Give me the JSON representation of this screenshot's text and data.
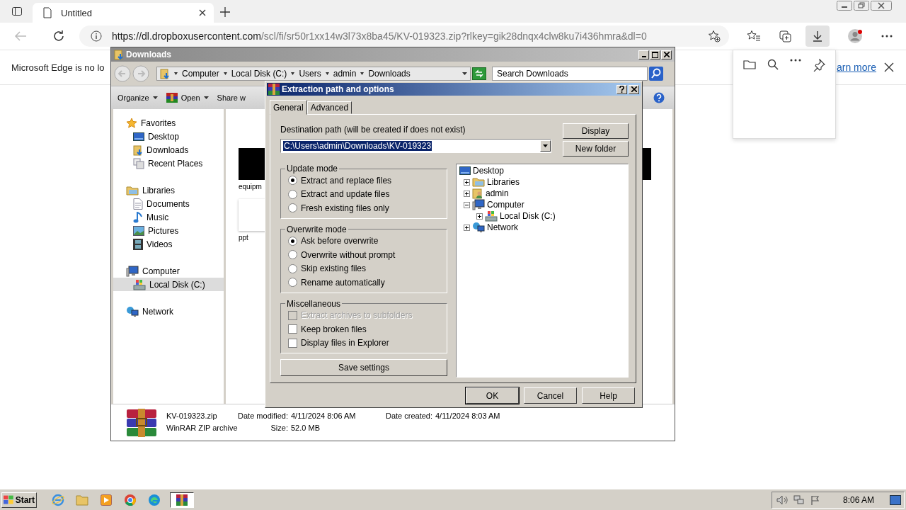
{
  "browser": {
    "tab": {
      "title": "Untitled"
    },
    "address": {
      "host": "https://dl.dropboxusercontent.com",
      "path": "/scl/fi/sr50r1xx14w3l73x8ba45/KV-019323.zip?rlkey=gik28dnqx4clw8ku7i436hmra&dl=0"
    },
    "infobar": {
      "message": "Microsoft Edge is no lo",
      "link": "arn more"
    }
  },
  "explorer": {
    "title": "Downloads",
    "breadcrumb": [
      "Computer",
      "Local Disk (C:)",
      "Users",
      "admin",
      "Downloads"
    ],
    "search": {
      "placeholder": "Search Downloads"
    },
    "toolbar": [
      {
        "label": "Organize",
        "kind": "menu"
      },
      {
        "label": "Open",
        "kind": "open"
      },
      {
        "label": "Share w",
        "kind": "plain"
      }
    ],
    "nav": [
      {
        "label": "Favorites",
        "kind": "star",
        "selected": false,
        "items": [
          {
            "label": "Desktop",
            "kind": "desktop",
            "selected": false
          },
          {
            "label": "Downloads",
            "kind": "downloads",
            "selected": false
          },
          {
            "label": "Recent Places",
            "kind": "recent",
            "selected": false
          }
        ]
      },
      {
        "label": "Libraries",
        "kind": "library",
        "selected": false,
        "items": [
          {
            "label": "Documents",
            "kind": "documents",
            "selected": false
          },
          {
            "label": "Music",
            "kind": "music",
            "selected": false
          },
          {
            "label": "Pictures",
            "kind": "pictures",
            "selected": false
          },
          {
            "label": "Videos",
            "kind": "videos",
            "selected": false
          }
        ]
      },
      {
        "label": "Computer",
        "kind": "computer",
        "selected": false,
        "items": [
          {
            "label": "Local Disk (C:)",
            "kind": "disk",
            "selected": true
          }
        ]
      },
      {
        "label": "Network",
        "kind": "network",
        "selected": false
      }
    ],
    "file_columns": [
      [
        {
          "name": "equipm",
          "kind": "dark"
        },
        {
          "name": "ppt",
          "kind": "light"
        }
      ],
      [
        {
          "kind": "dark"
        }
      ]
    ],
    "details": {
      "name": "KV-019323.zip",
      "type": "WinRAR ZIP archive",
      "modified_label": "Date modified:",
      "modified": "4/11/2024 8:06 AM",
      "size_label": "Size:",
      "size": "52.0 MB",
      "created_label": "Date created:",
      "created": "4/11/2024 8:03 AM"
    }
  },
  "dialog": {
    "title": "Extraction path and options",
    "tabs": [
      {
        "label": "General",
        "selected": true
      },
      {
        "label": "Advanced",
        "selected": false
      }
    ],
    "destination_label": "Destination path (will be created if does not exist)",
    "destination": "C:\\Users\\admin\\Downloads\\KV-019323",
    "side_buttons": [
      "Display",
      "New folder"
    ],
    "update_mode": {
      "title": "Update mode",
      "options": [
        {
          "label": "Extract and replace files",
          "selected": true
        },
        {
          "label": "Extract and update files",
          "selected": false
        },
        {
          "label": "Fresh existing files only",
          "selected": false
        }
      ]
    },
    "overwrite_mode": {
      "title": "Overwrite mode",
      "options": [
        {
          "label": "Ask before overwrite",
          "selected": true
        },
        {
          "label": "Overwrite without prompt",
          "selected": false
        },
        {
          "label": "Skip existing files",
          "selected": false
        },
        {
          "label": "Rename automatically",
          "selected": false
        }
      ]
    },
    "miscellaneous": {
      "title": "Miscellaneous",
      "options": [
        {
          "label": "Extract archives to subfolders",
          "checked": false,
          "disabled": true
        },
        {
          "label": "Keep broken files",
          "checked": false,
          "disabled": false
        },
        {
          "label": "Display files in Explorer",
          "checked": false,
          "disabled": false
        }
      ]
    },
    "save_button": "Save settings",
    "tree": [
      {
        "label": "Desktop",
        "kind": "desktop",
        "children": [
          {
            "label": "Libraries",
            "kind": "library",
            "expanded": false
          },
          {
            "label": "admin",
            "kind": "user",
            "expanded": false
          },
          {
            "label": "Computer",
            "kind": "computer",
            "expanded": true,
            "children": [
              {
                "label": "Local Disk (C:)",
                "kind": "disk",
                "expanded": false
              }
            ]
          },
          {
            "label": "Network",
            "kind": "network",
            "expanded": false
          }
        ]
      }
    ],
    "buttons": [
      {
        "label": "OK",
        "default": true
      },
      {
        "label": "Cancel",
        "default": false
      },
      {
        "label": "Help",
        "default": false
      }
    ]
  },
  "taskbar": {
    "start": "Start",
    "items": [
      {
        "kind": "ie",
        "selected": false
      },
      {
        "kind": "folder",
        "selected": false
      },
      {
        "kind": "media",
        "selected": false
      },
      {
        "kind": "chrome",
        "selected": false
      },
      {
        "kind": "edge",
        "selected": false
      },
      {
        "kind": "winrar",
        "selected": true
      }
    ],
    "clock": "8:06 AM"
  }
}
